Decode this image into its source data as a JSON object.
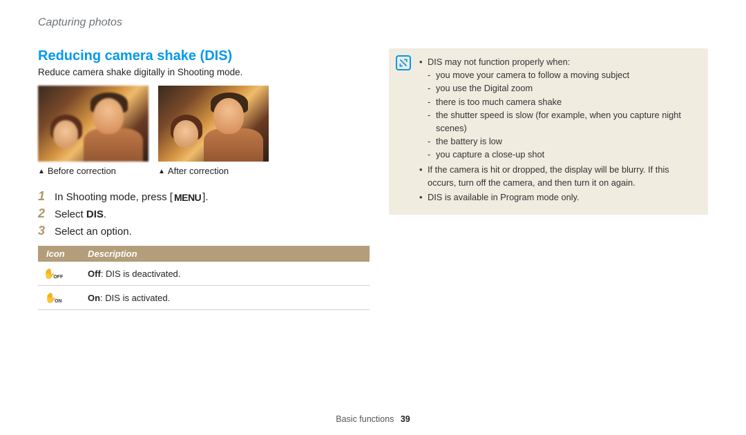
{
  "breadcrumb": "Capturing photos",
  "section_title": "Reducing camera shake (DIS)",
  "intro": "Reduce camera shake digitally in Shooting mode.",
  "captions": {
    "before": "Before correction",
    "after": "After correction"
  },
  "steps": {
    "s1_pre": "In Shooting mode, press [",
    "s1_menu": "MENU",
    "s1_post": "].",
    "s2_pre": "Select ",
    "s2_bold": "DIS",
    "s2_post": ".",
    "s3": "Select an option."
  },
  "table": {
    "head_icon": "Icon",
    "head_desc": "Description",
    "rows": [
      {
        "icon_sub": "OFF",
        "bold": "Off",
        "rest": ": DIS is deactivated."
      },
      {
        "icon_sub": "ON",
        "bold": "On",
        "rest": ": DIS is activated."
      }
    ]
  },
  "notes": {
    "lead": "DIS may not function properly when:",
    "subs": [
      "you move your camera to follow a moving subject",
      "you use the Digital zoom",
      "there is too much camera shake",
      "the shutter speed is slow (for example, when you capture night scenes)",
      "the battery is low",
      "you capture a close-up shot"
    ],
    "n2": "If the camera is hit or dropped, the display will be blurry. If this occurs, turn off the camera, and then turn it on again.",
    "n3": "DIS is available in Program mode only."
  },
  "footer": {
    "section": "Basic functions",
    "page": "39"
  }
}
